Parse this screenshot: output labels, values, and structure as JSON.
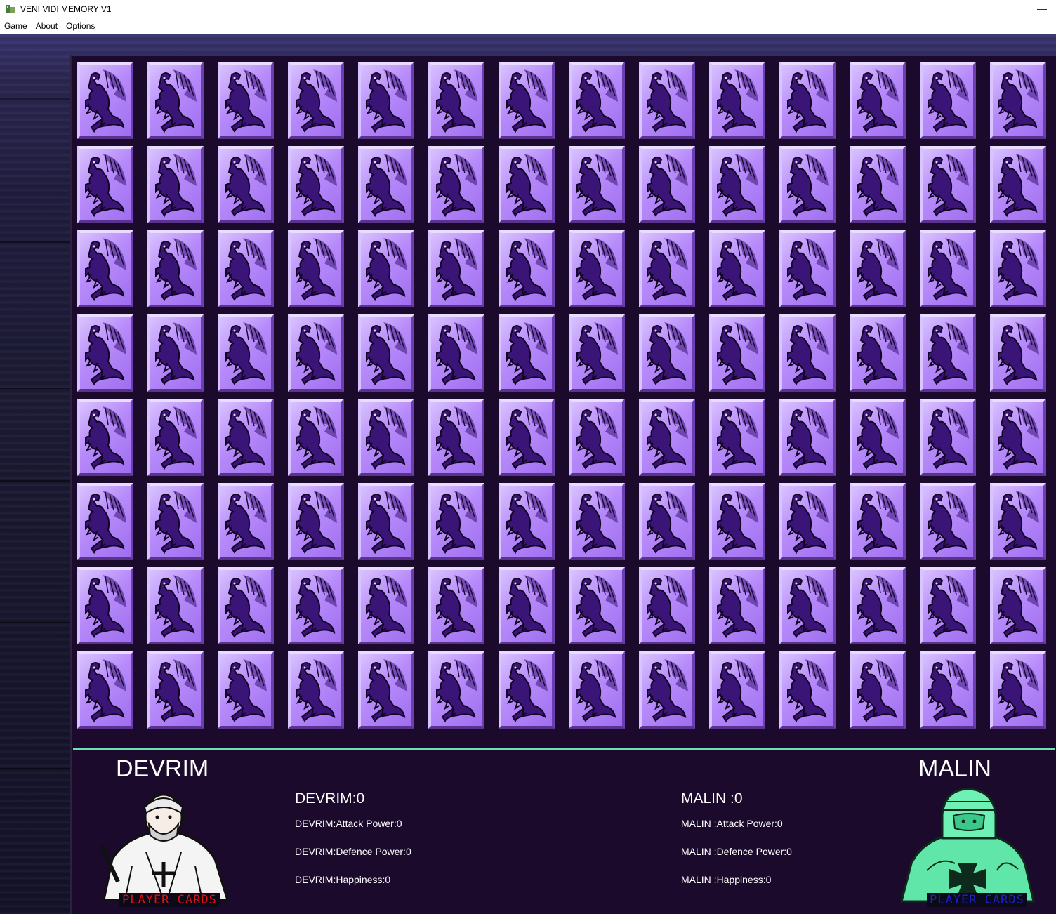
{
  "window": {
    "title": "VENI VIDI MEMORY V1",
    "minimize_glyph": "—"
  },
  "menu": {
    "items": [
      "Game",
      "About",
      "Options"
    ]
  },
  "board": {
    "rows": 8,
    "columns": 14,
    "card_back_icon": "dragon-icon",
    "card_colors": {
      "light": "#d9c2ff",
      "mid": "#b78bfa",
      "dark": "#5a338f",
      "dragon": "#3a1477"
    }
  },
  "players": [
    {
      "name": "DEVRIM",
      "score_label": "DEVRIM:0",
      "attack_label": "DEVRIM:Attack Power:0",
      "defence_label": "DEVRIM:Defence Power:0",
      "happiness_label": "DEVRIM:Happiness:0",
      "cards_label": "PLAYER CARDS",
      "cards_label_color": "#e01010",
      "avatar_icon": "knight-icon"
    },
    {
      "name": "MALIN",
      "score_label": "MALIN :0",
      "attack_label": "MALIN :Attack Power:0",
      "defence_label": "MALIN :Defence Power:0",
      "happiness_label": "MALIN :Happiness:0",
      "cards_label": "PLAYER CARDS",
      "cards_label_color": "#2020c0",
      "avatar_icon": "templar-knight-icon"
    }
  ],
  "colors": {
    "board_bg": "#1b0a2c",
    "divider": "#6fe0b0",
    "text": "#ffffff",
    "malin_knight": "#5fe6a8"
  }
}
